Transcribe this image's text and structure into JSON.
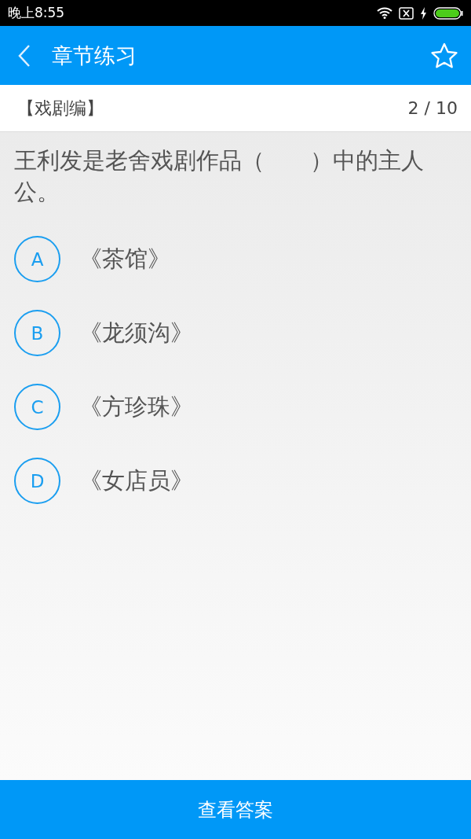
{
  "status_bar": {
    "time": "晚上8:55"
  },
  "header": {
    "title": "章节练习",
    "favorited": false
  },
  "subheader": {
    "category": "【戏剧编】",
    "progress": "2 / 10"
  },
  "question": {
    "text": "王利发是老舍戏剧作品（　　）中的主人公。",
    "options": [
      {
        "letter": "A",
        "text": "《茶馆》",
        "selected": false
      },
      {
        "letter": "B",
        "text": "《龙须沟》",
        "selected": false
      },
      {
        "letter": "C",
        "text": "《方珍珠》",
        "selected": false
      },
      {
        "letter": "D",
        "text": "《女店员》",
        "selected": false
      }
    ]
  },
  "footer": {
    "button": "查看答案"
  }
}
